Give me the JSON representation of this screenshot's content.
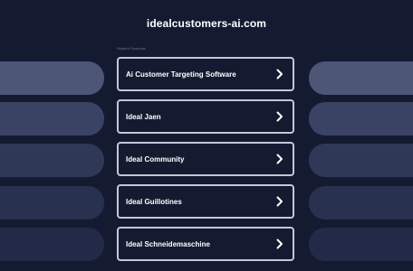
{
  "domain": "idealcustomers-ai.com",
  "related_label": "Related Searches",
  "links": [
    {
      "label": "Ai Customer Targeting Software"
    },
    {
      "label": "Ideal Jaen"
    },
    {
      "label": "Ideal Community"
    },
    {
      "label": "Ideal Guillotines"
    },
    {
      "label": "Ideal Schneidemaschine"
    }
  ],
  "colors": {
    "background": "#141b31",
    "box_border": "#c3c8d6",
    "pill_row1": "#4d5677",
    "pill_row2": "#3a4364",
    "pill_row3": "#2f3857",
    "pill_row4": "#283150",
    "pill_row5": "#222a48"
  },
  "icons": {
    "chevron": "chevron-right-icon"
  }
}
